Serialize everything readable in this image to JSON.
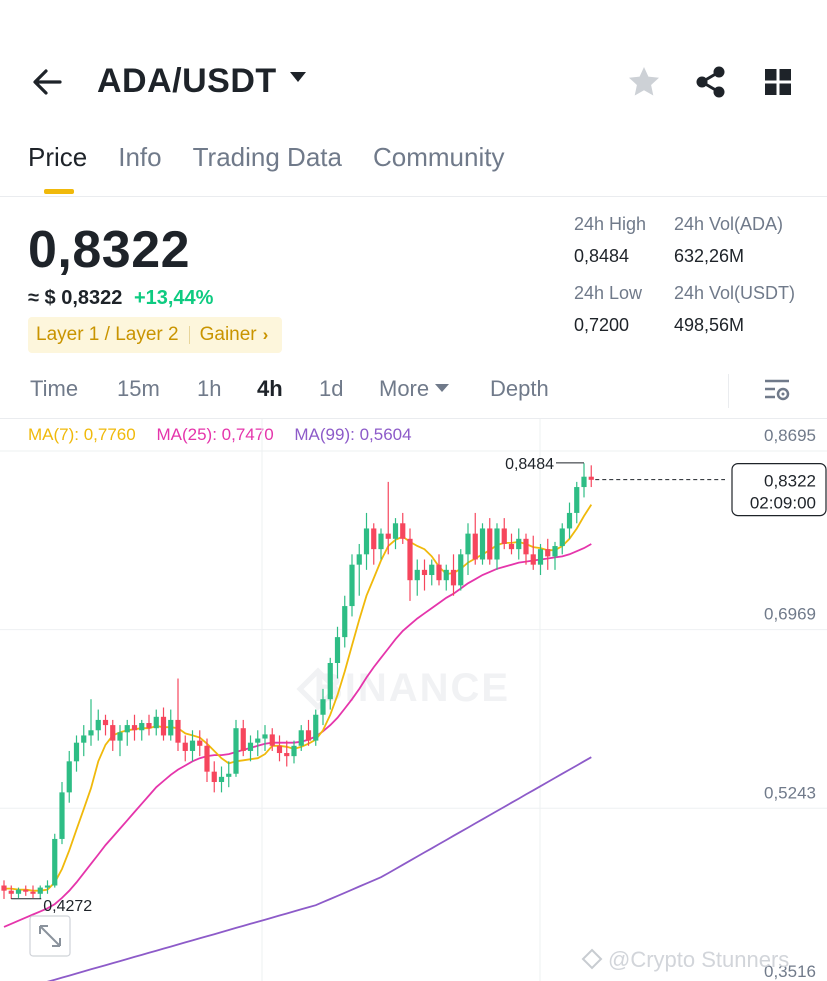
{
  "header": {
    "pair": "ADA/USDT",
    "back_icon": "back-arrow-icon",
    "fav_icon": "star-icon",
    "share_icon": "share-icon",
    "menu_icon": "grid-icon"
  },
  "tabs": [
    {
      "label": "Price",
      "active": true
    },
    {
      "label": "Info",
      "active": false
    },
    {
      "label": "Trading Data",
      "active": false
    },
    {
      "label": "Community",
      "active": false
    }
  ],
  "price": {
    "last": "0,8322",
    "usd_prefix": "≈ $",
    "usd": "0,8322",
    "change": "+13,44%",
    "tag1": "Layer 1 / Layer 2",
    "tag2": "Gainer",
    "tag_arrow": "›"
  },
  "stats": {
    "high_label": "24h High",
    "high": "0,8484",
    "low_label": "24h Low",
    "low": "0,7200",
    "vol_ada_label": "24h Vol(ADA)",
    "vol_ada": "632,26M",
    "vol_usdt_label": "24h Vol(USDT)",
    "vol_usdt": "498,56M"
  },
  "intervals": [
    {
      "label": "Time",
      "active": false
    },
    {
      "label": "15m",
      "active": false
    },
    {
      "label": "1h",
      "active": false
    },
    {
      "label": "4h",
      "active": true
    },
    {
      "label": "1d",
      "active": false
    },
    {
      "label": "More",
      "active": false
    },
    {
      "label": "Depth",
      "active": false
    }
  ],
  "ma": {
    "ma7": "MA(7): 0,7760",
    "ma25": "MA(25): 0,7470",
    "ma99": "MA(99): 0,5604"
  },
  "colors": {
    "up": "#2ebd85",
    "down": "#f6465d",
    "ma7": "#f0b90b",
    "ma25": "#e535ab",
    "ma99": "#8d5bc9",
    "accent": "#f0b90b"
  },
  "chart_data": {
    "type": "candlestick",
    "y_ticks": [
      "0,8695",
      "0,6969",
      "0,5243",
      "0,3516"
    ],
    "ylim": [
      0.3516,
      0.8695
    ],
    "high_marker": "0,8484",
    "low_marker": "0,4272",
    "last_price": "0,8322",
    "countdown": "02:09:00",
    "watermark": "BINANCE",
    "credit": "@Crypto Stunners",
    "candles": [
      [
        0.44,
        0.445,
        0.427,
        0.435
      ],
      [
        0.435,
        0.44,
        0.427,
        0.432
      ],
      [
        0.432,
        0.438,
        0.428,
        0.436
      ],
      [
        0.436,
        0.44,
        0.43,
        0.434
      ],
      [
        0.434,
        0.44,
        0.428,
        0.432
      ],
      [
        0.432,
        0.44,
        0.427,
        0.438
      ],
      [
        0.438,
        0.445,
        0.432,
        0.44
      ],
      [
        0.44,
        0.49,
        0.438,
        0.485
      ],
      [
        0.485,
        0.54,
        0.48,
        0.53
      ],
      [
        0.53,
        0.57,
        0.52,
        0.56
      ],
      [
        0.56,
        0.585,
        0.55,
        0.578
      ],
      [
        0.578,
        0.595,
        0.565,
        0.585
      ],
      [
        0.585,
        0.62,
        0.575,
        0.59
      ],
      [
        0.59,
        0.61,
        0.58,
        0.6
      ],
      [
        0.6,
        0.605,
        0.585,
        0.595
      ],
      [
        0.595,
        0.6,
        0.57,
        0.58
      ],
      [
        0.58,
        0.595,
        0.565,
        0.588
      ],
      [
        0.588,
        0.6,
        0.575,
        0.595
      ],
      [
        0.595,
        0.605,
        0.58,
        0.59
      ],
      [
        0.59,
        0.6,
        0.58,
        0.597
      ],
      [
        0.597,
        0.605,
        0.585,
        0.592
      ],
      [
        0.592,
        0.61,
        0.585,
        0.603
      ],
      [
        0.603,
        0.612,
        0.58,
        0.585
      ],
      [
        0.585,
        0.61,
        0.58,
        0.6
      ],
      [
        0.6,
        0.64,
        0.57,
        0.578
      ],
      [
        0.578,
        0.585,
        0.56,
        0.57
      ],
      [
        0.57,
        0.59,
        0.56,
        0.58
      ],
      [
        0.58,
        0.59,
        0.565,
        0.575
      ],
      [
        0.575,
        0.582,
        0.54,
        0.55
      ],
      [
        0.55,
        0.56,
        0.53,
        0.54
      ],
      [
        0.54,
        0.555,
        0.53,
        0.545
      ],
      [
        0.545,
        0.56,
        0.535,
        0.548
      ],
      [
        0.548,
        0.6,
        0.545,
        0.592
      ],
      [
        0.592,
        0.6,
        0.565,
        0.57
      ],
      [
        0.57,
        0.585,
        0.56,
        0.578
      ],
      [
        0.578,
        0.59,
        0.565,
        0.582
      ],
      [
        0.582,
        0.595,
        0.57,
        0.586
      ],
      [
        0.586,
        0.592,
        0.57,
        0.575
      ],
      [
        0.575,
        0.585,
        0.56,
        0.568
      ],
      [
        0.568,
        0.58,
        0.555,
        0.565
      ],
      [
        0.565,
        0.58,
        0.558,
        0.575
      ],
      [
        0.575,
        0.595,
        0.57,
        0.59
      ],
      [
        0.59,
        0.6,
        0.575,
        0.58
      ],
      [
        0.58,
        0.61,
        0.575,
        0.605
      ],
      [
        0.605,
        0.63,
        0.595,
        0.62
      ],
      [
        0.62,
        0.66,
        0.61,
        0.655
      ],
      [
        0.655,
        0.69,
        0.64,
        0.68
      ],
      [
        0.68,
        0.72,
        0.67,
        0.71
      ],
      [
        0.71,
        0.76,
        0.7,
        0.75
      ],
      [
        0.75,
        0.77,
        0.72,
        0.76
      ],
      [
        0.76,
        0.8,
        0.745,
        0.785
      ],
      [
        0.785,
        0.79,
        0.75,
        0.765
      ],
      [
        0.765,
        0.785,
        0.755,
        0.78
      ],
      [
        0.78,
        0.83,
        0.76,
        0.775
      ],
      [
        0.775,
        0.795,
        0.765,
        0.79
      ],
      [
        0.79,
        0.8,
        0.77,
        0.775
      ],
      [
        0.775,
        0.785,
        0.715,
        0.735
      ],
      [
        0.735,
        0.755,
        0.72,
        0.745
      ],
      [
        0.745,
        0.755,
        0.725,
        0.74
      ],
      [
        0.74,
        0.755,
        0.73,
        0.75
      ],
      [
        0.75,
        0.76,
        0.73,
        0.735
      ],
      [
        0.735,
        0.75,
        0.725,
        0.745
      ],
      [
        0.745,
        0.76,
        0.72,
        0.73
      ],
      [
        0.73,
        0.765,
        0.725,
        0.76
      ],
      [
        0.76,
        0.79,
        0.74,
        0.78
      ],
      [
        0.78,
        0.8,
        0.75,
        0.755
      ],
      [
        0.755,
        0.79,
        0.75,
        0.785
      ],
      [
        0.785,
        0.795,
        0.75,
        0.755
      ],
      [
        0.755,
        0.79,
        0.745,
        0.785
      ],
      [
        0.785,
        0.795,
        0.765,
        0.77
      ],
      [
        0.77,
        0.78,
        0.76,
        0.765
      ],
      [
        0.765,
        0.785,
        0.755,
        0.775
      ],
      [
        0.775,
        0.78,
        0.75,
        0.76
      ],
      [
        0.76,
        0.778,
        0.745,
        0.75
      ],
      [
        0.75,
        0.77,
        0.74,
        0.765
      ],
      [
        0.765,
        0.775,
        0.745,
        0.758
      ],
      [
        0.758,
        0.772,
        0.745,
        0.768
      ],
      [
        0.768,
        0.79,
        0.76,
        0.785
      ],
      [
        0.785,
        0.81,
        0.775,
        0.8
      ],
      [
        0.8,
        0.83,
        0.79,
        0.825
      ],
      [
        0.825,
        0.848,
        0.815,
        0.835
      ],
      [
        0.835,
        0.846,
        0.825,
        0.832
      ]
    ],
    "ma7": [
      0.437,
      0.437,
      0.436,
      0.436,
      0.435,
      0.435,
      0.436,
      0.443,
      0.456,
      0.474,
      0.494,
      0.514,
      0.534,
      0.56,
      0.576,
      0.585,
      0.588,
      0.59,
      0.591,
      0.592,
      0.592,
      0.594,
      0.593,
      0.593,
      0.592,
      0.587,
      0.585,
      0.583,
      0.577,
      0.57,
      0.563,
      0.558,
      0.56,
      0.561,
      0.562,
      0.563,
      0.567,
      0.575,
      0.575,
      0.574,
      0.572,
      0.574,
      0.577,
      0.581,
      0.59,
      0.605,
      0.624,
      0.647,
      0.672,
      0.697,
      0.72,
      0.737,
      0.754,
      0.768,
      0.774,
      0.777,
      0.772,
      0.768,
      0.765,
      0.758,
      0.748,
      0.741,
      0.742,
      0.746,
      0.752,
      0.756,
      0.76,
      0.764,
      0.769,
      0.771,
      0.771,
      0.772,
      0.77,
      0.767,
      0.766,
      0.764,
      0.764,
      0.768,
      0.775,
      0.785,
      0.797,
      0.808
    ],
    "ma25": [
      0.4,
      0.403,
      0.406,
      0.409,
      0.412,
      0.415,
      0.418,
      0.422,
      0.428,
      0.435,
      0.443,
      0.452,
      0.461,
      0.47,
      0.479,
      0.487,
      0.495,
      0.503,
      0.511,
      0.519,
      0.527,
      0.535,
      0.541,
      0.547,
      0.552,
      0.556,
      0.56,
      0.563,
      0.565,
      0.566,
      0.566,
      0.567,
      0.569,
      0.571,
      0.573,
      0.575,
      0.577,
      0.578,
      0.578,
      0.578,
      0.578,
      0.579,
      0.581,
      0.584,
      0.589,
      0.595,
      0.602,
      0.611,
      0.62,
      0.63,
      0.641,
      0.651,
      0.66,
      0.669,
      0.678,
      0.686,
      0.692,
      0.698,
      0.703,
      0.708,
      0.713,
      0.718,
      0.722,
      0.727,
      0.732,
      0.736,
      0.74,
      0.743,
      0.746,
      0.748,
      0.75,
      0.752,
      0.753,
      0.754,
      0.755,
      0.756,
      0.757,
      0.758,
      0.76,
      0.763,
      0.766,
      0.77
    ],
    "ma99": [
      0.335,
      0.337,
      0.339,
      0.341,
      0.343,
      0.345,
      0.347,
      0.349,
      0.351,
      0.353,
      0.355,
      0.357,
      0.359,
      0.361,
      0.363,
      0.365,
      0.367,
      0.369,
      0.371,
      0.373,
      0.375,
      0.377,
      0.379,
      0.381,
      0.383,
      0.385,
      0.387,
      0.389,
      0.391,
      0.393,
      0.395,
      0.397,
      0.399,
      0.401,
      0.403,
      0.405,
      0.407,
      0.409,
      0.411,
      0.413,
      0.415,
      0.417,
      0.419,
      0.421,
      0.424,
      0.427,
      0.43,
      0.433,
      0.436,
      0.439,
      0.442,
      0.445,
      0.448,
      0.452,
      0.456,
      0.46,
      0.464,
      0.468,
      0.472,
      0.476,
      0.48,
      0.484,
      0.488,
      0.492,
      0.496,
      0.5,
      0.504,
      0.508,
      0.512,
      0.516,
      0.52,
      0.524,
      0.528,
      0.532,
      0.536,
      0.54,
      0.544,
      0.548,
      0.552,
      0.556,
      0.56,
      0.564
    ]
  }
}
